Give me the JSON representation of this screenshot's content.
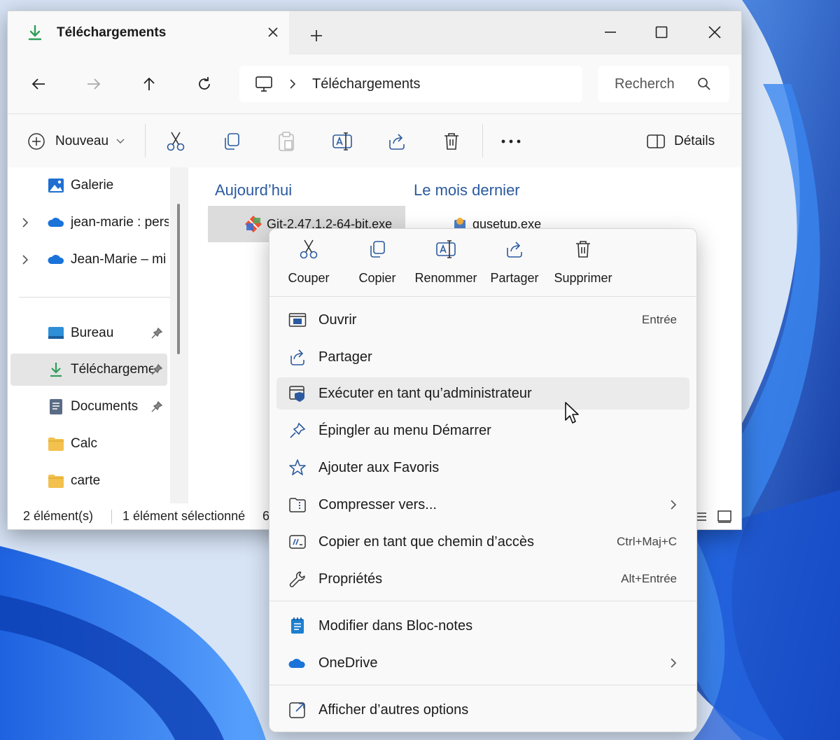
{
  "window": {
    "tab_title": "Téléchargements",
    "address_path": "Téléchargements",
    "search_placeholder": "Recherch"
  },
  "toolbar": {
    "new_label": "Nouveau",
    "details_label": "Détails"
  },
  "sidebar": {
    "items": [
      {
        "label": "Galerie",
        "icon": "gallery-icon"
      },
      {
        "label": "jean-marie : personnel",
        "icon": "onedrive-icon"
      },
      {
        "label": "Jean-Marie – mi",
        "icon": "onedrive-icon"
      },
      {
        "label": "Bureau",
        "icon": "desktop-icon"
      },
      {
        "label": "Téléchargements",
        "icon": "download-icon"
      },
      {
        "label": "Documents",
        "icon": "documents-icon"
      },
      {
        "label": "Calc",
        "icon": "folder-icon"
      },
      {
        "label": "carte",
        "icon": "folder-icon"
      }
    ]
  },
  "content": {
    "groups": [
      {
        "heading": "Aujourd’hui",
        "files": [
          "Git-2.47.1.2-64-bit.exe"
        ]
      },
      {
        "heading": "Le mois dernier",
        "files": [
          "gusetup.exe"
        ]
      }
    ]
  },
  "status": {
    "count": "2 élément(s)",
    "selection": "1 élément sélectionné",
    "size_partial": "6"
  },
  "context_menu": {
    "quick_actions": [
      {
        "label": "Couper",
        "icon": "cut-icon"
      },
      {
        "label": "Copier",
        "icon": "copy-icon"
      },
      {
        "label": "Renommer",
        "icon": "rename-icon"
      },
      {
        "label": "Partager",
        "icon": "share-icon"
      },
      {
        "label": "Supprimer",
        "icon": "delete-icon"
      }
    ],
    "items": [
      {
        "label": "Ouvrir",
        "shortcut": "Entrée",
        "icon": "open-icon"
      },
      {
        "label": "Partager",
        "shortcut": "",
        "icon": "share-icon"
      },
      {
        "label": "Exécuter en tant qu’administrateur",
        "shortcut": "",
        "icon": "admin-shield-icon"
      },
      {
        "label": "Épingler au menu Démarrer",
        "shortcut": "",
        "icon": "pin-icon"
      },
      {
        "label": "Ajouter aux Favoris",
        "shortcut": "",
        "icon": "star-icon"
      },
      {
        "label": "Compresser vers...",
        "shortcut": "",
        "icon": "zip-icon"
      },
      {
        "label": "Copier en tant que chemin d’accès",
        "shortcut": "Ctrl+Maj+C",
        "icon": "copy-path-icon"
      },
      {
        "label": "Propriétés",
        "shortcut": "Alt+Entrée",
        "icon": "wrench-icon"
      },
      {
        "label": "Modifier dans Bloc-notes",
        "shortcut": "",
        "icon": "notepad-icon"
      },
      {
        "label": "OneDrive",
        "shortcut": "",
        "icon": "onedrive-icon"
      },
      {
        "label": "Afficher d’autres options",
        "shortcut": "",
        "icon": "more-options-icon"
      }
    ]
  },
  "colors": {
    "accent": "#0067c0",
    "group_heading": "#2b5aa0",
    "download_green": "#2f9e5a",
    "onedrive_blue": "#1a73d9",
    "folder_yellow": "#f2c14e"
  }
}
